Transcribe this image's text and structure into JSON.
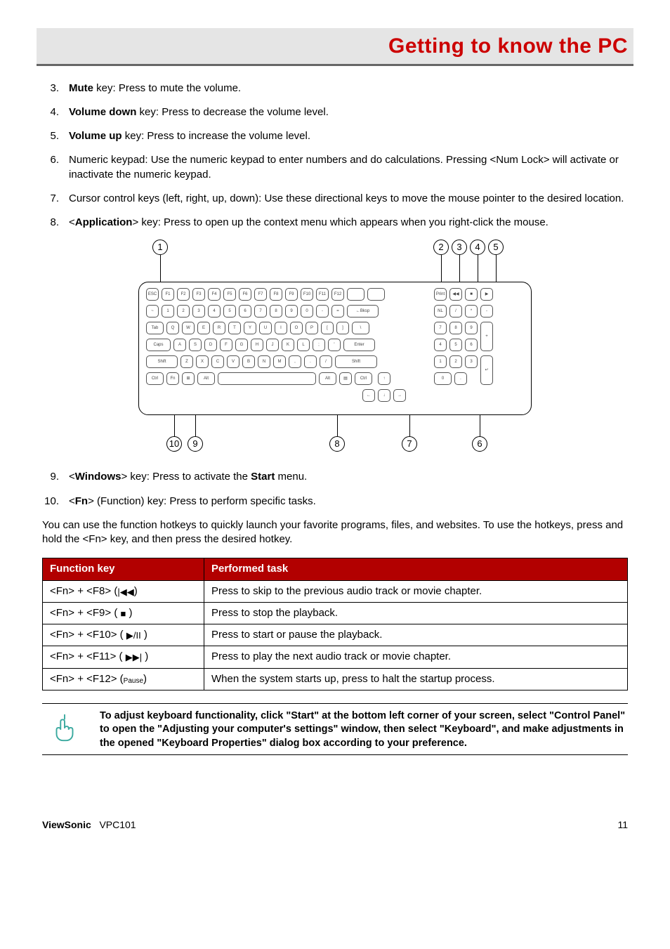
{
  "chapter_title": "Getting to know the PC",
  "list_a": [
    {
      "n": "3.",
      "txt": [
        "",
        "Mute",
        " key: Press to mute the volume."
      ]
    },
    {
      "n": "4.",
      "txt": [
        "",
        "Volume down",
        " key: Press to decrease the volume level."
      ]
    },
    {
      "n": "5.",
      "txt": [
        "",
        "Volume up",
        " key: Press to increase the volume level."
      ]
    },
    {
      "n": "6.",
      "txt": [
        "Numeric keypad: Use the numeric keypad to enter numbers and do calculations. Pressing <Num Lock> will activate or inactivate the numeric keypad.",
        "",
        ""
      ]
    },
    {
      "n": "7.",
      "txt": [
        "Cursor control keys (left, right, up, down): Use these directional keys to move the mouse pointer to the desired location.",
        "",
        ""
      ]
    },
    {
      "n": "8.",
      "txt": [
        "<",
        "Application",
        "> key: Press to open up the context menu which appears when you right-click the mouse."
      ]
    }
  ],
  "list_b": [
    {
      "n": " 9.",
      "txt": [
        "<",
        "Windows",
        "> key: Press to activate the ",
        "Start",
        " menu."
      ]
    },
    {
      "n": "10.",
      "txt": [
        "<",
        "Fn",
        "> (Function) key: Press to perform specific tasks."
      ]
    }
  ],
  "para": "You can use the function hotkeys to quickly launch your favorite programs, files, and websites. To use the hotkeys, press and hold the <Fn> key, and then press the desired hotkey.",
  "table": {
    "headers": [
      "Function key",
      "Performed task"
    ],
    "rows": [
      {
        "k": "<Fn> + <F8>",
        "icon": "|◀◀",
        "t": "Press to skip to the previous audio track or movie chapter."
      },
      {
        "k": "<Fn> + <F9>",
        "icon": "■",
        "t": "Press to stop the playback."
      },
      {
        "k": "<Fn> + <F10>",
        "icon": "▶/II",
        "t": "Press to start or pause the playback."
      },
      {
        "k": "<Fn> + <F11>",
        "icon": "▶▶|",
        "t": "Press to play the next audio track or movie chapter."
      },
      {
        "k": "<Fn> + <F12>",
        "icon": "Pause",
        "t": "When the system starts up, press to halt the startup process."
      }
    ]
  },
  "note": "To adjust keyboard functionality, click \"Start\" at the bottom left corner of your screen, select \"Control Panel\" to open the \"Adjusting your computer's settings\" window, then select \"Keyboard\", and make adjustments in the opened \"Keyboard Properties\" dialog box according to your preference.",
  "callouts": {
    "1": "1",
    "2": "2",
    "3": "3",
    "4": "4",
    "5": "5",
    "6": "6",
    "7": "7",
    "8": "8",
    "9": "9",
    "10": "10"
  },
  "footer": {
    "brand": "ViewSonic",
    "model": "VPC101",
    "page": "11"
  }
}
